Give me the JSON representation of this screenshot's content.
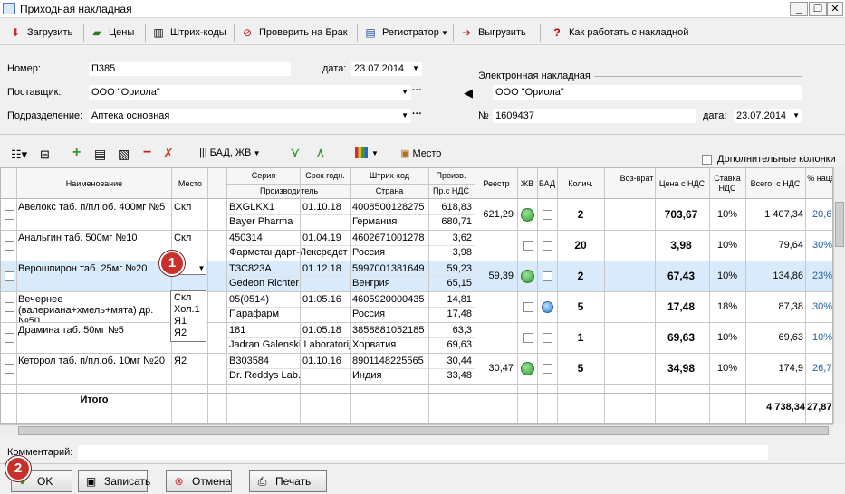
{
  "window": {
    "title": "Приходная накладная"
  },
  "toolbar": {
    "items": [
      {
        "label": "Загрузить",
        "icon": "load-icon"
      },
      {
        "label": "Цены",
        "icon": "prices-icon"
      },
      {
        "label": "Штрих-коды",
        "icon": "barcode-icon"
      },
      {
        "label": "Проверить на Брак",
        "icon": "check-defect-icon"
      },
      {
        "label": "Регистратор",
        "icon": "register-icon"
      },
      {
        "label": "Выгрузить",
        "icon": "export-icon"
      },
      {
        "label": "Как работать с накладной",
        "icon": "help-icon"
      }
    ]
  },
  "form": {
    "number_label": "Номер:",
    "number_value": "П385",
    "date_label": "дата:",
    "date_value": "23.07.2014",
    "supplier_label": "Поставщик:",
    "supplier_value": "ООО \"Ориола\"",
    "division_label": "Подразделение:",
    "division_value": "Аптека основная",
    "einvoice_label": "Электронная накладная",
    "einvoice_supplier": "ООО \"Ориола\"",
    "einvoice_no_label": "№",
    "einvoice_no": "1609437",
    "einvoice_date_label": "дата:",
    "einvoice_date": "23.07.2014"
  },
  "grid_toolbar": {
    "bad_jv": "БАД, ЖВ",
    "place": "Место",
    "extra_columns": "Дополнительные колонки"
  },
  "headers": {
    "name": "Наименование",
    "place": "Место",
    "series": "Серия",
    "shelf": "Срок годн.",
    "producer": "Производитель",
    "barcode": "Штрих-код",
    "country": "Страна",
    "prod": "Произв.",
    "price_vat": "Пр.с НДС",
    "registry": "Реестр",
    "jv": "ЖВ",
    "bad": "БАД",
    "qty": "Колич.",
    "return": "Воз-врат",
    "price_with_vat": "Цена с НДС",
    "vat_rate": "Ставка НДС",
    "total_vat": "Всего, с НДС",
    "markup": "% нацен"
  },
  "rows": [
    {
      "name": "Авелокс таб. п/пл.об. 400мг №5",
      "place": "Скл",
      "series": "BXGLKX1",
      "shelf": "01.10.18",
      "producer": "Bayer Pharma",
      "barcode": "4008500128275",
      "country": "Германия",
      "prod": "618,83",
      "price_vat": "680,71",
      "registry": "621,29",
      "jv": true,
      "bad": false,
      "qty": "2",
      "price": "703,67",
      "vat": "10%",
      "total": "1 407,34",
      "markup": "20,6"
    },
    {
      "name": "Анальгин таб. 500мг №10",
      "place": "Скл",
      "series": "450314",
      "shelf": "01.04.19",
      "producer": "Фармстандарт-Лексредст",
      "barcode": "4602671001278",
      "country": "Россия",
      "prod": "3,62",
      "price_vat": "3,98",
      "registry": "",
      "jv": false,
      "bad": false,
      "qty": "20",
      "price": "3,98",
      "vat": "10%",
      "total": "79,64",
      "markup": "30%"
    },
    {
      "name": "Верошпирон таб. 25мг №20",
      "place": "",
      "series": "ТЗС823А",
      "shelf": "01.12.18",
      "producer": "Gedeon Richter",
      "barcode": "5997001381649",
      "country": "Венгрия",
      "prod": "59,23",
      "price_vat": "65,15",
      "registry": "59,39",
      "jv": true,
      "bad": false,
      "qty": "2",
      "price": "67,43",
      "vat": "10%",
      "total": "134,86",
      "markup": "23%"
    },
    {
      "name": "Вечернее (валериана+хмель+мята) др. №50",
      "place": "",
      "series": "05(0514)",
      "shelf": "01.05.16",
      "producer": "Парафарм",
      "barcode": "4605920000435",
      "country": "Россия",
      "prod": "14,81",
      "price_vat": "17,48",
      "registry": "",
      "jv": false,
      "bad": true,
      "qty": "5",
      "price": "17,48",
      "vat": "18%",
      "total": "87,38",
      "markup": "30%"
    },
    {
      "name": "Драмина таб. 50мг №5",
      "place": "",
      "series": "181",
      "shelf": "01.05.18",
      "producer": "Jadran Galenski Laboratorij",
      "barcode": "3858881052185",
      "country": "Хорватия",
      "prod": "63,3",
      "price_vat": "69,63",
      "registry": "",
      "jv": false,
      "bad": false,
      "qty": "1",
      "price": "69,63",
      "vat": "10%",
      "total": "69,63",
      "markup": "10%"
    },
    {
      "name": "Кеторол таб. п/пл.об. 10мг №20",
      "place": "Я2",
      "series": "В303584",
      "shelf": "01.10.16",
      "producer": "Dr. Reddys Lab.",
      "barcode": "8901148225565",
      "country": "Индия",
      "prod": "30,44",
      "price_vat": "33,48",
      "registry": "30,47",
      "jv": true,
      "bad": false,
      "qty": "5",
      "price": "34,98",
      "vat": "10%",
      "total": "174,9",
      "markup": "26,7"
    }
  ],
  "dropdown": {
    "options": [
      "Скл",
      "Хол.1",
      "Я1",
      "Я2"
    ]
  },
  "totals": {
    "label": "Итого",
    "total": "4 738,34",
    "markup": "27,87"
  },
  "comment_label": "Комментарий:",
  "badges": {
    "one": "1",
    "two": "2"
  },
  "buttons": {
    "ok": "OK",
    "save": "Записать",
    "cancel": "Отмена",
    "print": "Печать"
  }
}
